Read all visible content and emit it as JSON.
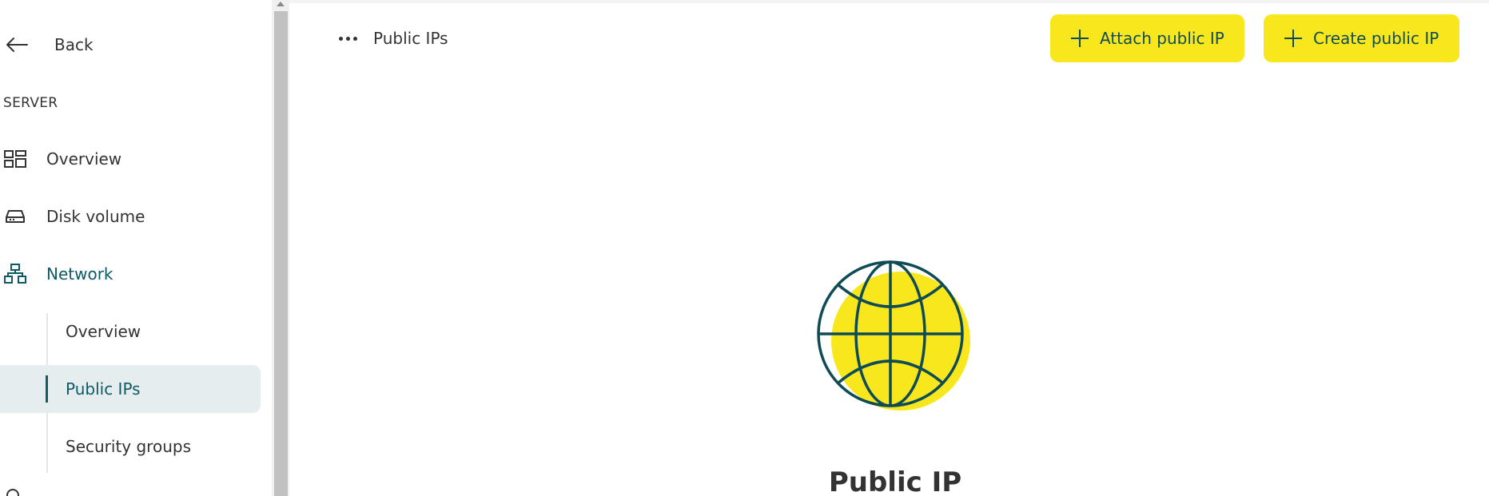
{
  "sidebar": {
    "back_label": "Back",
    "section_title": "SERVER",
    "items": [
      {
        "label": "Overview",
        "icon": "grid-icon"
      },
      {
        "label": "Disk volume",
        "icon": "hard-drive-icon"
      },
      {
        "label": "Network",
        "icon": "network-icon"
      }
    ],
    "network_sub": [
      {
        "label": "Overview"
      },
      {
        "label": "Public IPs"
      },
      {
        "label": "Security groups"
      }
    ]
  },
  "header": {
    "breadcrumb_current": "Public IPs",
    "attach_label": "Attach public IP",
    "create_label": "Create public IP"
  },
  "empty_state": {
    "title": "Public IP",
    "icon": "globe-icon"
  },
  "colors": {
    "accent_yellow": "#f9e71e",
    "accent_teal": "#0e5a66",
    "selected_bg": "#e6edef"
  }
}
